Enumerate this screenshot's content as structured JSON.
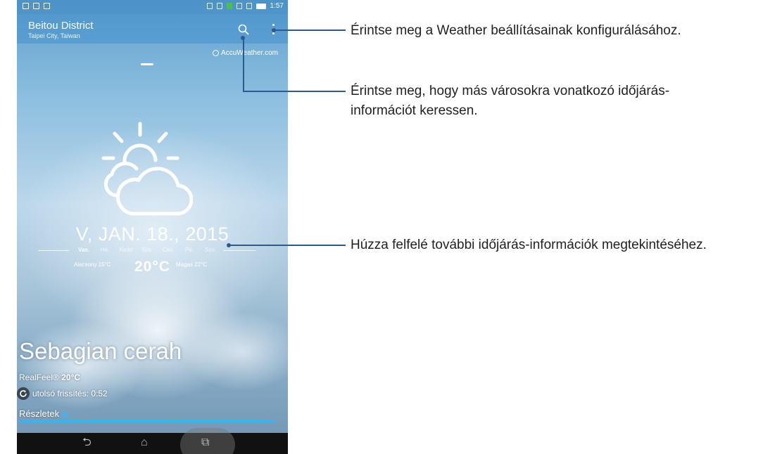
{
  "phone": {
    "city": "Beitou District",
    "region": "Taipei City, Taiwan",
    "status_time": "1:57",
    "provider": "AccuWeather.com",
    "date": "V, JAN. 18., 2015",
    "days": [
      "Vas.",
      "Hé.",
      "Kedd",
      "Sze.",
      "Csü.",
      "Pé.",
      "Szo."
    ],
    "low": "Alacsony 15°C",
    "temp": "20°C",
    "high": "Magas 22°C",
    "condition": "Sebagian cerah",
    "realfeel_label": "RealFeel®",
    "realfeel_value": "20°C",
    "last_update": "utolsó frissítés: 0:52",
    "details_label": "Részletek",
    "nav": {
      "back": "⮌",
      "home": "⌂",
      "recent": "⧉"
    }
  },
  "callouts": {
    "settings": "Érintse meg a Weather beállításainak konfigurálásához.",
    "search_line1": "Érintse meg, hogy más városokra vonatkozó időjárás-",
    "search_line2": "információt keressen.",
    "swipe": "Húzza felfelé további időjárás-információk megtekintéséhez."
  },
  "colors": {
    "accent": "#35b5f3",
    "callout_line": "#2d5a8c"
  }
}
